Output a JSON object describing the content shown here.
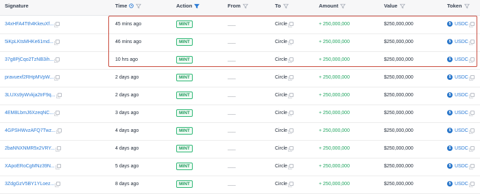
{
  "header": {
    "signature": "Signature",
    "time": "Time",
    "action": "Action",
    "from": "From",
    "to": "To",
    "amount": "Amount",
    "value": "Value",
    "token": "Token"
  },
  "colors": {
    "accent_blue": "#2b7bd6",
    "amount_green": "#1fa45f",
    "highlight_red": "#c8483a"
  },
  "rows": [
    {
      "signature": "34xHFA4Tth4KkeuXf...",
      "time": "45 mins ago",
      "action": "MINT",
      "from": "___",
      "to": "Circle",
      "amount": "+ 250,000,000",
      "value": "$250,000,000",
      "token": "USDC"
    },
    {
      "signature": "5iKpLKtsMHKe61md...",
      "time": "46 mins ago",
      "action": "MINT",
      "from": "___",
      "to": "Circle",
      "amount": "+ 250,000,000",
      "value": "$250,000,000",
      "token": "USDC"
    },
    {
      "signature": "37g8PjCqo2TzNB3ih...",
      "time": "10 hrs ago",
      "action": "MINT",
      "from": "___",
      "to": "Circle",
      "amount": "+ 250,000,000",
      "value": "$250,000,000",
      "token": "USDC"
    },
    {
      "signature": "pravuexf2RHpMVpW...",
      "time": "2 days ago",
      "action": "MINT",
      "from": "___",
      "to": "Circle",
      "amount": "+ 250,000,000",
      "value": "$250,000,000",
      "token": "USDC"
    },
    {
      "signature": "3LUXs9yWvkja2trF9q...",
      "time": "2 days ago",
      "action": "MINT",
      "from": "___",
      "to": "Circle",
      "amount": "+ 250,000,000",
      "value": "$250,000,000",
      "token": "USDC"
    },
    {
      "signature": "4EM8LbmJ6XzeqNC...",
      "time": "3 days ago",
      "action": "MINT",
      "from": "___",
      "to": "Circle",
      "amount": "+ 250,000,000",
      "value": "$250,000,000",
      "token": "USDC"
    },
    {
      "signature": "4GPSHWvzAFQ7Twz...",
      "time": "4 days ago",
      "action": "MINT",
      "from": "___",
      "to": "Circle",
      "amount": "+ 250,000,000",
      "value": "$250,000,000",
      "token": "USDC"
    },
    {
      "signature": "2baNNXNMR5x2VRY...",
      "time": "4 days ago",
      "action": "MINT",
      "from": "___",
      "to": "Circle",
      "amount": "+ 250,000,000",
      "value": "$250,000,000",
      "token": "USDC"
    },
    {
      "signature": "XApoERoCgMNz39N...",
      "time": "5 days ago",
      "action": "MINT",
      "from": "___",
      "to": "Circle",
      "amount": "+ 250,000,000",
      "value": "$250,000,000",
      "token": "USDC"
    },
    {
      "signature": "3ZdgGzV5BY1YLoez...",
      "time": "8 days ago",
      "action": "MINT",
      "from": "___",
      "to": "Circle",
      "amount": "+ 250,000,000",
      "value": "$250,000,000",
      "token": "USDC"
    }
  ]
}
